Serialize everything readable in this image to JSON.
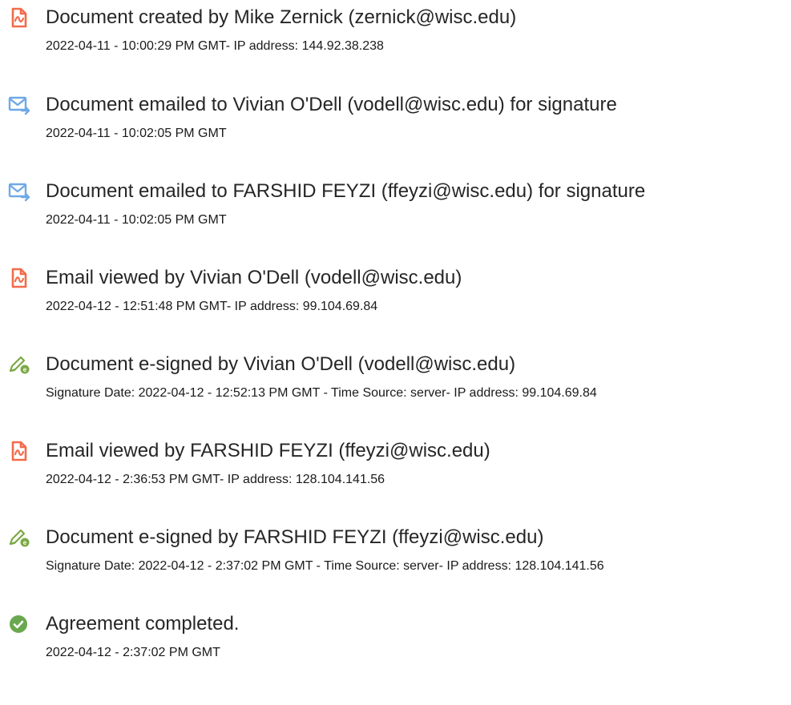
{
  "events": [
    {
      "icon": "document-created-icon",
      "title": "Document created by Mike Zernick (zernick@wisc.edu)",
      "detail": "2022-04-11 - 10:00:29 PM GMT- IP address: 144.92.38.238"
    },
    {
      "icon": "email-sent-icon",
      "title": "Document emailed to Vivian O'Dell (vodell@wisc.edu) for signature",
      "detail": "2022-04-11 - 10:02:05 PM GMT"
    },
    {
      "icon": "email-sent-icon",
      "title": "Document emailed to FARSHID FEYZI (ffeyzi@wisc.edu) for signature",
      "detail": "2022-04-11 - 10:02:05 PM GMT"
    },
    {
      "icon": "document-viewed-icon",
      "title": "Email viewed by Vivian O'Dell (vodell@wisc.edu)",
      "detail": "2022-04-12 - 12:51:48 PM GMT- IP address: 99.104.69.84"
    },
    {
      "icon": "esign-icon",
      "title": "Document e-signed by Vivian O'Dell (vodell@wisc.edu)",
      "detail": "Signature Date: 2022-04-12 - 12:52:13 PM GMT - Time Source: server- IP address: 99.104.69.84"
    },
    {
      "icon": "document-viewed-icon",
      "title": "Email viewed by FARSHID FEYZI (ffeyzi@wisc.edu)",
      "detail": "2022-04-12 - 2:36:53 PM GMT- IP address: 128.104.141.56"
    },
    {
      "icon": "esign-icon",
      "title": "Document e-signed by FARSHID FEYZI (ffeyzi@wisc.edu)",
      "detail": "Signature Date: 2022-04-12 - 2:37:02 PM GMT - Time Source: server- IP address: 128.104.141.56"
    },
    {
      "icon": "checkmark-icon",
      "title": "Agreement completed.",
      "detail": "2022-04-12 - 2:37:02 PM GMT"
    }
  ],
  "colors": {
    "document_icon": "#f26b4a",
    "email_icon": "#6fa9e6",
    "esign_icon": "#7ba944",
    "complete_icon": "#6aa84f",
    "title_text": "#262626",
    "detail_text": "#1a1a1a"
  }
}
